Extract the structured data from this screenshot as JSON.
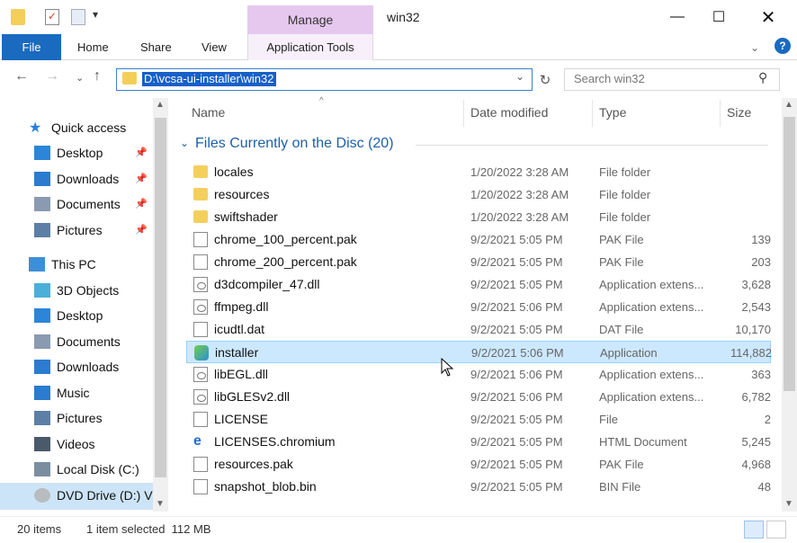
{
  "window": {
    "title": "win32",
    "context_tab": "Manage"
  },
  "ribbon": {
    "file": "File",
    "tabs": [
      "Home",
      "Share",
      "View"
    ],
    "app_tools": "Application Tools"
  },
  "address": {
    "path": "D:\\vcsa-ui-installer\\win32",
    "search_placeholder": "Search win32"
  },
  "nav": {
    "items": [
      {
        "label": "Quick access",
        "icon": "star-icon",
        "pinned": false
      },
      {
        "label": "Desktop",
        "icon": "desktop-icon",
        "pinned": true
      },
      {
        "label": "Downloads",
        "icon": "download-icon",
        "pinned": true
      },
      {
        "label": "Documents",
        "icon": "documents-icon",
        "pinned": true
      },
      {
        "label": "Pictures",
        "icon": "pictures-icon",
        "pinned": true
      },
      {
        "label": "This PC",
        "icon": "pc-icon",
        "pinned": false
      },
      {
        "label": "3D Objects",
        "icon": "cube-icon",
        "pinned": false
      },
      {
        "label": "Desktop",
        "icon": "desktop-icon",
        "pinned": false
      },
      {
        "label": "Documents",
        "icon": "documents-icon",
        "pinned": false
      },
      {
        "label": "Downloads",
        "icon": "download-icon",
        "pinned": false
      },
      {
        "label": "Music",
        "icon": "music-icon",
        "pinned": false
      },
      {
        "label": "Pictures",
        "icon": "pictures-icon",
        "pinned": false
      },
      {
        "label": "Videos",
        "icon": "videos-icon",
        "pinned": false
      },
      {
        "label": "Local Disk (C:)",
        "icon": "disk-icon",
        "pinned": false
      },
      {
        "label": "DVD Drive (D:) V",
        "icon": "dvd-icon",
        "pinned": false
      }
    ]
  },
  "columns": {
    "name": "Name",
    "date": "Date modified",
    "type": "Type",
    "size": "Size"
  },
  "group": {
    "label": "Files Currently on the Disc (20)"
  },
  "files": [
    {
      "name": "locales",
      "date": "1/20/2022 3:28 AM",
      "type": "File folder",
      "size": "",
      "kind": "folder"
    },
    {
      "name": "resources",
      "date": "1/20/2022 3:28 AM",
      "type": "File folder",
      "size": "",
      "kind": "folder"
    },
    {
      "name": "swiftshader",
      "date": "1/20/2022 3:28 AM",
      "type": "File folder",
      "size": "",
      "kind": "folder"
    },
    {
      "name": "chrome_100_percent.pak",
      "date": "9/2/2021 5:05 PM",
      "type": "PAK File",
      "size": "139",
      "kind": "file"
    },
    {
      "name": "chrome_200_percent.pak",
      "date": "9/2/2021 5:05 PM",
      "type": "PAK File",
      "size": "203",
      "kind": "file"
    },
    {
      "name": "d3dcompiler_47.dll",
      "date": "9/2/2021 5:05 PM",
      "type": "Application extens...",
      "size": "3,628",
      "kind": "dll"
    },
    {
      "name": "ffmpeg.dll",
      "date": "9/2/2021 5:06 PM",
      "type": "Application extens...",
      "size": "2,543",
      "kind": "dll"
    },
    {
      "name": "icudtl.dat",
      "date": "9/2/2021 5:05 PM",
      "type": "DAT File",
      "size": "10,170",
      "kind": "file"
    },
    {
      "name": "installer",
      "date": "9/2/2021 5:06 PM",
      "type": "Application",
      "size": "114,882",
      "kind": "app"
    },
    {
      "name": "libEGL.dll",
      "date": "9/2/2021 5:06 PM",
      "type": "Application extens...",
      "size": "363",
      "kind": "dll"
    },
    {
      "name": "libGLESv2.dll",
      "date": "9/2/2021 5:06 PM",
      "type": "Application extens...",
      "size": "6,782",
      "kind": "dll"
    },
    {
      "name": "LICENSE",
      "date": "9/2/2021 5:05 PM",
      "type": "File",
      "size": "2",
      "kind": "file"
    },
    {
      "name": "LICENSES.chromium",
      "date": "9/2/2021 5:05 PM",
      "type": "HTML Document",
      "size": "5,245",
      "kind": "html"
    },
    {
      "name": "resources.pak",
      "date": "9/2/2021 5:05 PM",
      "type": "PAK File",
      "size": "4,968",
      "kind": "file"
    },
    {
      "name": "snapshot_blob.bin",
      "date": "9/2/2021 5:05 PM",
      "type": "BIN File",
      "size": "48",
      "kind": "file"
    }
  ],
  "selected_file_index": 8,
  "status": {
    "count": "20 items",
    "selection": "1 item selected  112 MB"
  },
  "colors": {
    "accent": "#1a6ac0",
    "manage": "#e6c8ee",
    "selection": "#cce8ff"
  }
}
